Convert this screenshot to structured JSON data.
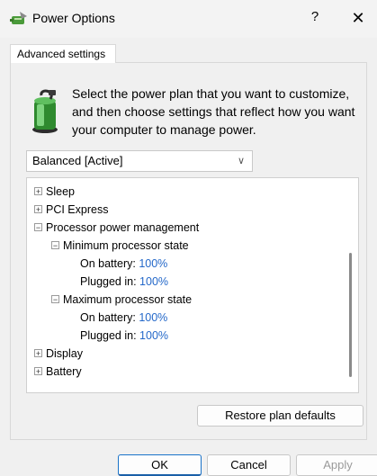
{
  "window": {
    "title": "Power Options",
    "help_glyph": "?",
    "close_glyph": "✕"
  },
  "tab": {
    "label": "Advanced settings"
  },
  "intro": {
    "text": "Select the power plan that you want to customize, and then choose settings that reflect how you want your computer to manage power."
  },
  "plan_select": {
    "value": "Balanced [Active]"
  },
  "tree": {
    "sleep": "Sleep",
    "pci_express": "PCI Express",
    "processor_power_management": "Processor power management",
    "minimum_processor_state": "Minimum processor state",
    "min_on_battery_label": "On battery:",
    "min_on_battery_value": "100%",
    "min_plugged_in_label": "Plugged in:",
    "min_plugged_in_value": "100%",
    "maximum_processor_state": "Maximum processor state",
    "max_on_battery_label": "On battery:",
    "max_on_battery_value": "100%",
    "max_plugged_in_label": "Plugged in:",
    "max_plugged_in_value": "100%",
    "display": "Display",
    "battery": "Battery"
  },
  "buttons": {
    "restore": "Restore plan defaults",
    "ok": "OK",
    "cancel": "Cancel",
    "apply": "Apply"
  },
  "icons": {
    "app": "power-options-icon",
    "plan": "battery-plug-icon"
  },
  "colors": {
    "value_link": "#2468c9",
    "ok_border": "#1a73c9"
  }
}
